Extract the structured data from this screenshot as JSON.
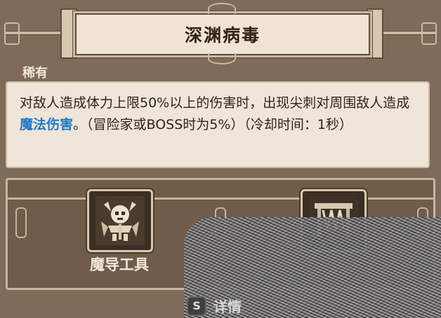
{
  "header": {
    "title": "深渊病毒"
  },
  "rarity": "稀有",
  "description": {
    "part1": "对敌人造成体力上限50%以上的伤害时，出现尖刺对周围敌人造成",
    "highlight": "魔法伤害",
    "part2": "。（冒险家或BOSS时为5%）（冷却时间：1秒）",
    "highlight_color": "#1e78c9"
  },
  "items": [
    {
      "icon": "skeleton-demon-icon",
      "label": "魔导工具"
    },
    {
      "icon": "trap-cage-icon",
      "label": ""
    }
  ],
  "hint": {
    "key": "S",
    "label": "详情"
  }
}
